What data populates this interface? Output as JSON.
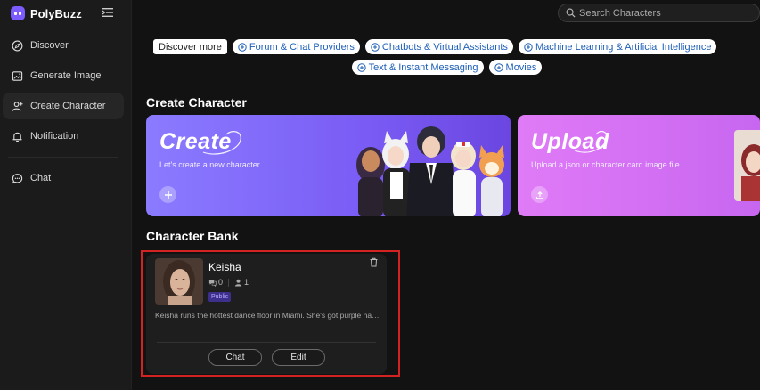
{
  "brand": {
    "name": "PolyBuzz"
  },
  "nav": {
    "items": [
      {
        "label": "Discover",
        "icon": "compass-icon"
      },
      {
        "label": "Generate Image",
        "icon": "image-icon"
      },
      {
        "label": "Create Character",
        "icon": "user-plus-icon",
        "active": true
      },
      {
        "label": "Notification",
        "icon": "bell-icon"
      },
      {
        "label": "Chat",
        "icon": "chat-icon"
      }
    ]
  },
  "search": {
    "placeholder": "Search Characters"
  },
  "tags": {
    "discover_more": "Discover more",
    "items": [
      "Forum & Chat Providers",
      "Chatbots & Virtual Assistants",
      "Machine Learning & Artificial Intelligence",
      "Text & Instant Messaging",
      "Movies"
    ]
  },
  "create_section": {
    "title": "Create Character",
    "create_card": {
      "title": "Create",
      "subtitle": "Let's create a new character"
    },
    "upload_card": {
      "title": "Upload",
      "subtitle": "Upload a json or character card image file"
    }
  },
  "bank": {
    "title": "Character Bank",
    "character": {
      "name": "Keisha",
      "chats": "0",
      "users": "1",
      "visibility": "Public",
      "description": "Keisha runs the hottest dance floor in Miami. She's got purple hair and a fiery attitude.",
      "chat_label": "Chat",
      "edit_label": "Edit"
    }
  },
  "colors": {
    "accent": "#7a5cf5",
    "upload_accent": "#d270f4",
    "tag_text": "#1d5fb8",
    "highlight": "#d32222"
  }
}
